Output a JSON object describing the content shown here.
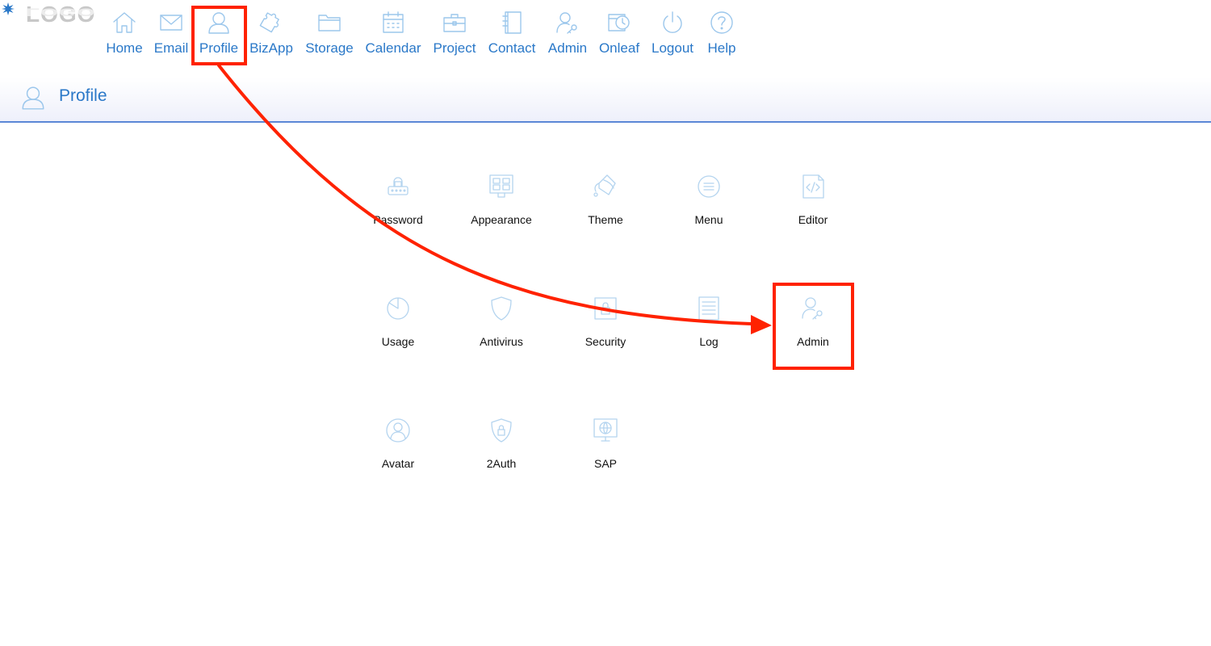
{
  "logo": {
    "text": "LOGO"
  },
  "nav": {
    "items": [
      {
        "id": "home",
        "label": "Home",
        "icon": "home-icon"
      },
      {
        "id": "email",
        "label": "Email",
        "icon": "envelope-icon"
      },
      {
        "id": "profile",
        "label": "Profile",
        "icon": "person-icon"
      },
      {
        "id": "bizapp",
        "label": "BizApp",
        "icon": "puzzle-icon"
      },
      {
        "id": "storage",
        "label": "Storage",
        "icon": "folder-icon"
      },
      {
        "id": "calendar",
        "label": "Calendar",
        "icon": "calendar-icon"
      },
      {
        "id": "project",
        "label": "Project",
        "icon": "briefcase-icon"
      },
      {
        "id": "contact",
        "label": "Contact",
        "icon": "address-book-icon"
      },
      {
        "id": "admin",
        "label": "Admin",
        "icon": "user-key-icon"
      },
      {
        "id": "onleaf",
        "label": "Onleaf",
        "icon": "clock-calendar-icon"
      },
      {
        "id": "logout",
        "label": "Logout",
        "icon": "power-icon"
      },
      {
        "id": "help",
        "label": "Help",
        "icon": "question-icon"
      }
    ]
  },
  "header": {
    "title": "Profile",
    "icon": "person-icon"
  },
  "tiles": [
    {
      "label": "Password",
      "icon": "password-lock-icon"
    },
    {
      "label": "Appearance",
      "icon": "monitor-layout-icon"
    },
    {
      "label": "Theme",
      "icon": "paint-bucket-icon"
    },
    {
      "label": "Menu",
      "icon": "menu-lines-icon"
    },
    {
      "label": "Editor",
      "icon": "code-file-icon"
    },
    {
      "label": "Usage",
      "icon": "pie-chart-icon"
    },
    {
      "label": "Antivirus",
      "icon": "shield-icon"
    },
    {
      "label": "Security",
      "icon": "lock-box-icon"
    },
    {
      "label": "Log",
      "icon": "log-list-icon"
    },
    {
      "label": "Admin",
      "icon": "user-key-icon"
    },
    {
      "label": "Avatar",
      "icon": "avatar-icon"
    },
    {
      "label": "2Auth",
      "icon": "shield-lock-icon"
    },
    {
      "label": "SAP",
      "icon": "globe-monitor-icon"
    }
  ],
  "colors": {
    "nav_label": "#2a78c8",
    "icon_stroke": "#9cc7ec",
    "header_border": "#5b88d6",
    "annotation": "#ff2200"
  }
}
